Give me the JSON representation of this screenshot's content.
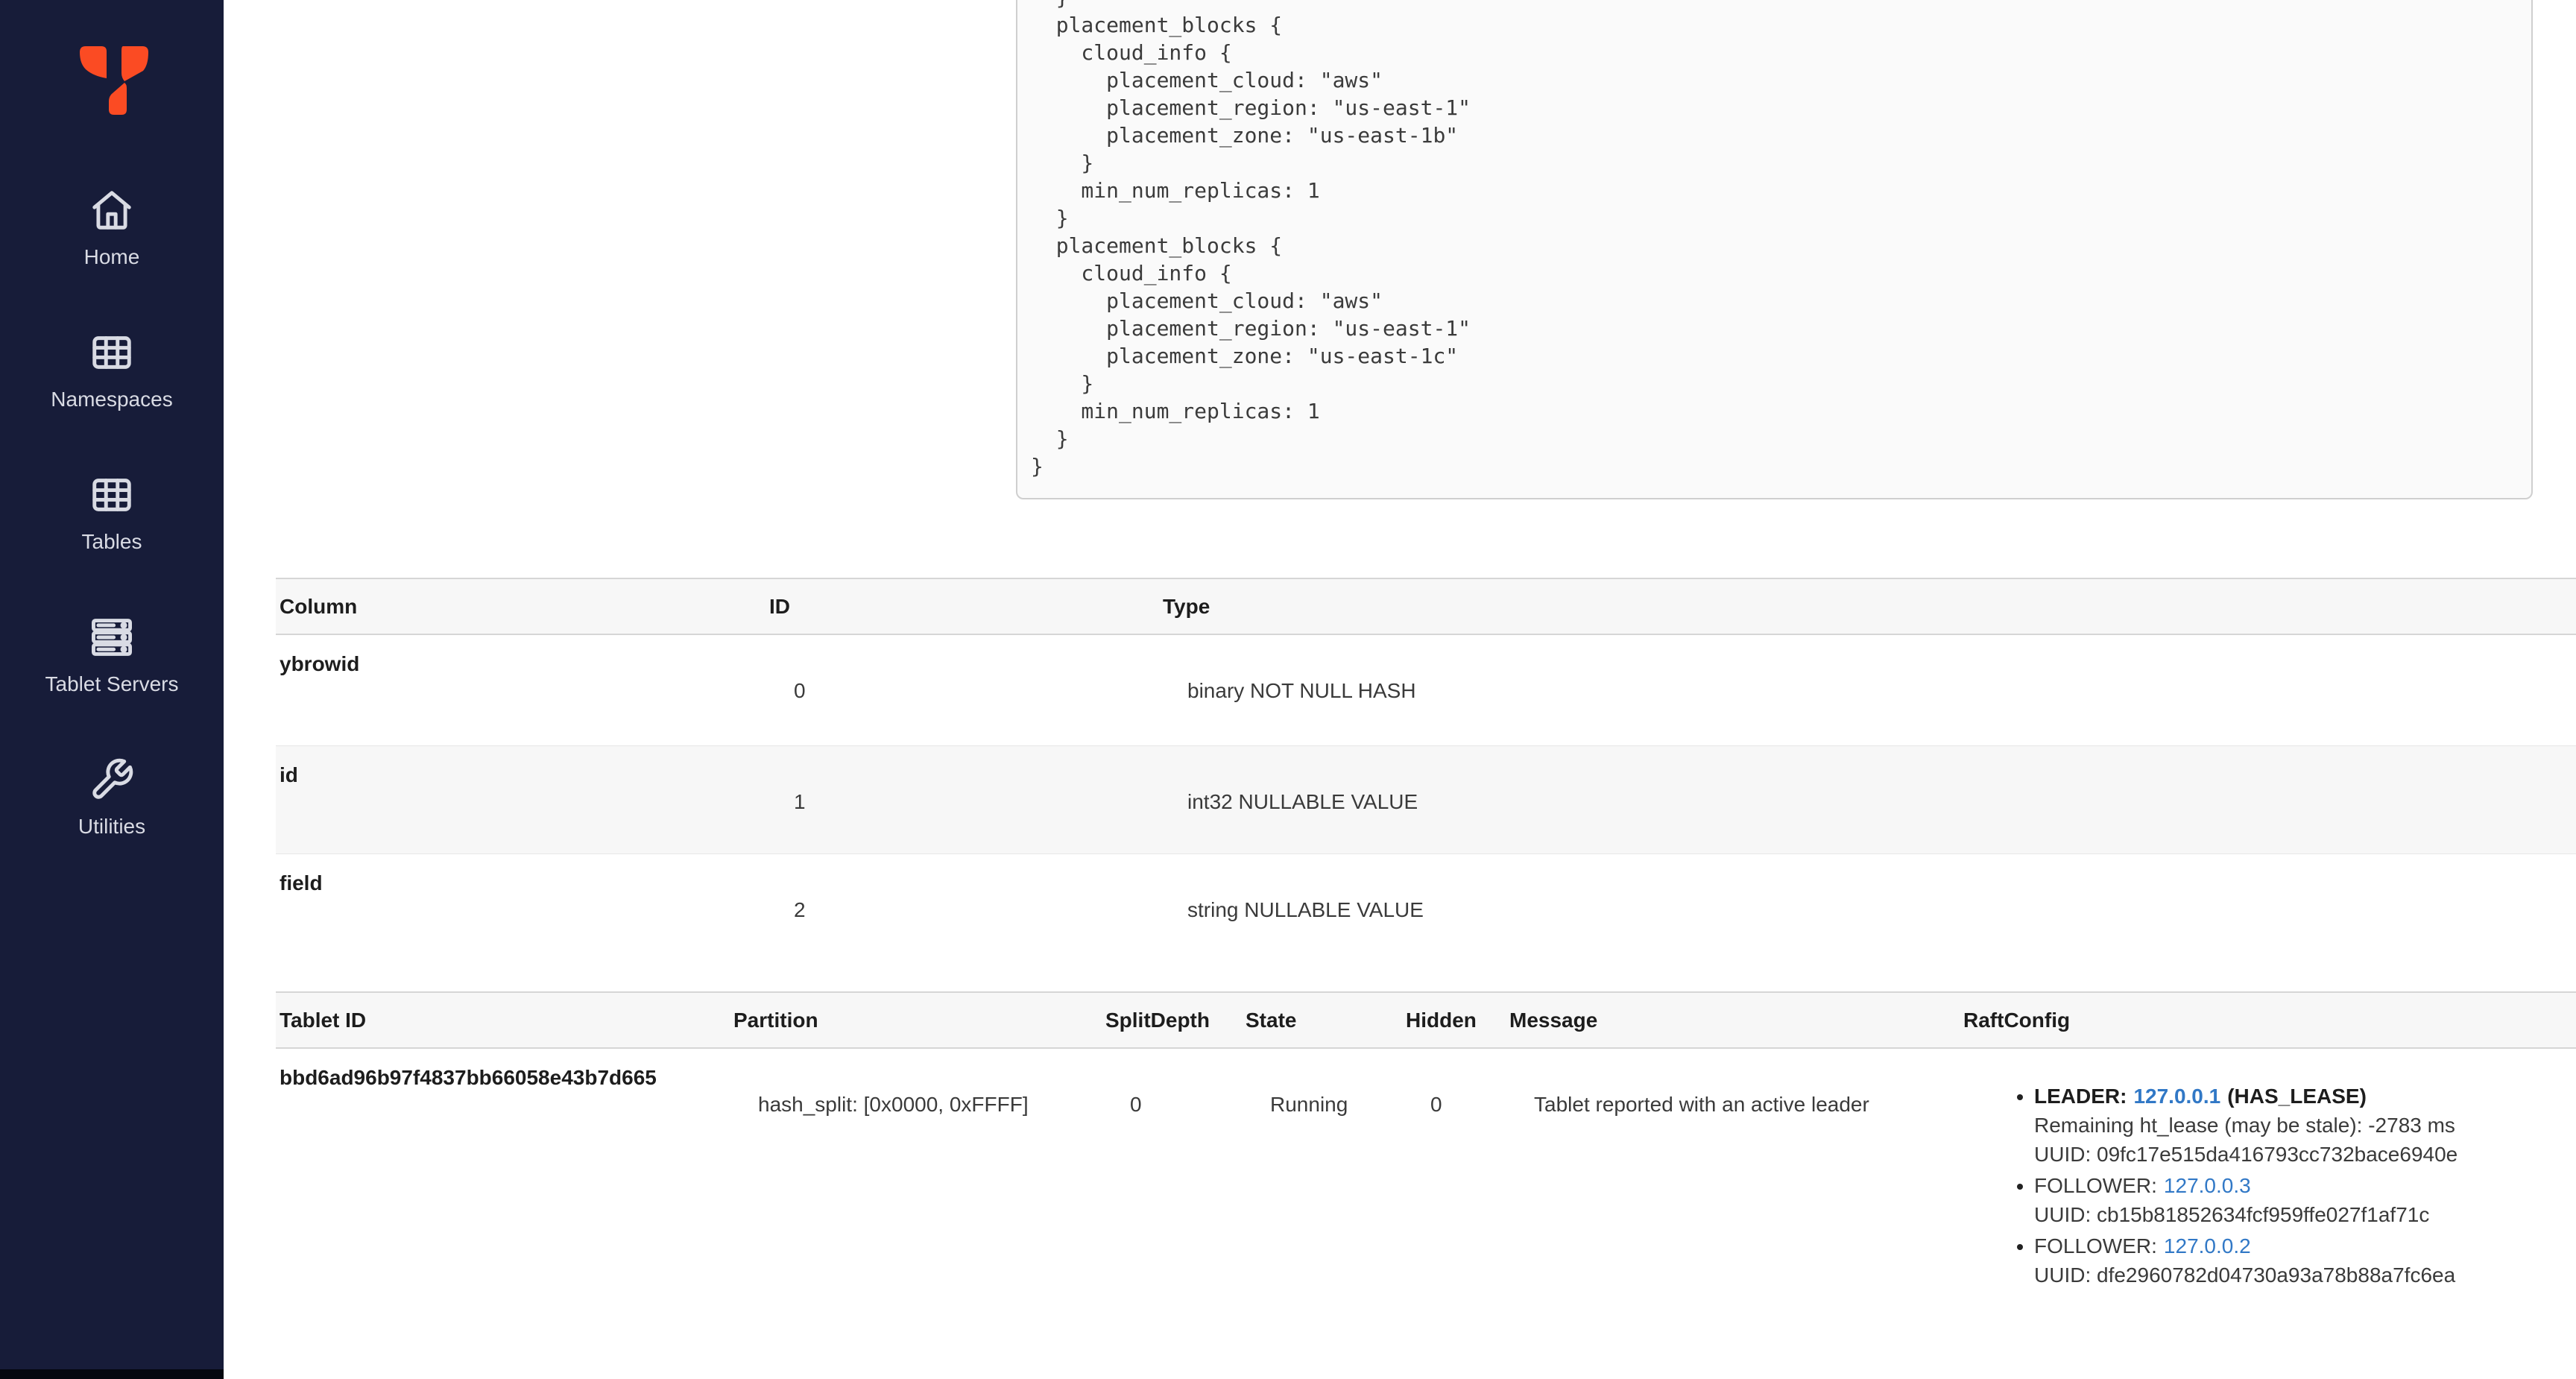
{
  "colors": {
    "sidebar_bg": "#171c39",
    "sidebar_bottom_strip": "#05070f",
    "logo_orange": "#fb4b23",
    "link_blue": "#3178c6",
    "table_header_bg": "#f7f7f7",
    "row_stripe_bg": "#f7f7f7",
    "code_bg": "#fafafa",
    "code_border": "#cfcfcf"
  },
  "sidebar": {
    "items": [
      {
        "label": "Home",
        "icon": "home-icon"
      },
      {
        "label": "Namespaces",
        "icon": "grid-icon"
      },
      {
        "label": "Tables",
        "icon": "grid-icon"
      },
      {
        "label": "Tablet Servers",
        "icon": "server-stack-icon"
      },
      {
        "label": "Utilities",
        "icon": "wrench-icon"
      }
    ]
  },
  "replication_info": {
    "code_text": "  }\n  placement_blocks {\n    cloud_info {\n      placement_cloud: \"aws\"\n      placement_region: \"us-east-1\"\n      placement_zone: \"us-east-1b\"\n    }\n    min_num_replicas: 1\n  }\n  placement_blocks {\n    cloud_info {\n      placement_cloud: \"aws\"\n      placement_region: \"us-east-1\"\n      placement_zone: \"us-east-1c\"\n    }\n    min_num_replicas: 1\n  }\n}"
  },
  "columns_table": {
    "headers": [
      "Column",
      "ID",
      "Type"
    ],
    "rows": [
      {
        "name": "ybrowid",
        "id": "0",
        "type": "binary NOT NULL HASH"
      },
      {
        "name": "id",
        "id": "1",
        "type": "int32 NULLABLE VALUE"
      },
      {
        "name": "field",
        "id": "2",
        "type": "string NULLABLE VALUE"
      }
    ]
  },
  "tablets_table": {
    "headers": [
      "Tablet ID",
      "Partition",
      "SplitDepth",
      "State",
      "Hidden",
      "Message",
      "RaftConfig"
    ],
    "row": {
      "tablet_id": "bbd6ad96b97f4837bb66058e43b7d665",
      "partition": "hash_split: [0x0000, 0xFFFF]",
      "split_depth": "0",
      "state": "Running",
      "hidden": "0",
      "message": "Tablet reported with an active leader",
      "raft": [
        {
          "role": "LEADER:",
          "ip": "127.0.0.1",
          "suffix": "(HAS_LEASE)",
          "lease": "Remaining ht_lease (may be stale): -2783 ms",
          "uuid": "UUID: 09fc17e515da416793cc732bace6940e"
        },
        {
          "role": "FOLLOWER:",
          "ip": "127.0.0.3",
          "uuid": "UUID: cb15b81852634fcf959ffe027f1af71c"
        },
        {
          "role": "FOLLOWER:",
          "ip": "127.0.0.2",
          "uuid": "UUID: dfe2960782d04730a93a78b88a7fc6ea"
        }
      ]
    }
  }
}
